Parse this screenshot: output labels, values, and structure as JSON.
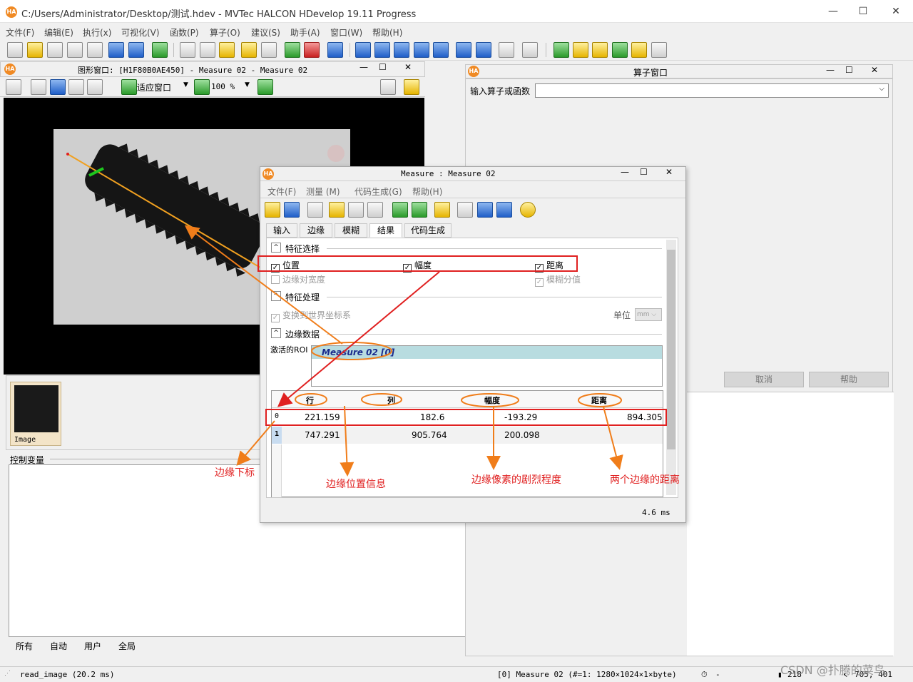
{
  "app": {
    "title": "C:/Users/Administrator/Desktop/测试.hdev - MVTec HALCON HDevelop 19.11 Progress",
    "min": "—",
    "max": "☐",
    "close": "✕",
    "logo": "HA"
  },
  "menu": [
    "文件(F)",
    "编辑(E)",
    "执行(x)",
    "可视化(V)",
    "函数(P)",
    "算子(O)",
    "建议(S)",
    "助手(A)",
    "窗口(W)",
    "帮助(H)"
  ],
  "graphics": {
    "title": "图形窗口: [H1F80B0AE450] - Measure 02 - Measure 02",
    "fit": "适应窗口",
    "zoom": "100 %"
  },
  "variables": {
    "image_label": "Image",
    "control_label": "控制变量",
    "tabs": [
      "所有",
      "自动",
      "用户",
      "全局"
    ]
  },
  "operator": {
    "title": "算子窗口",
    "label": "输入算子或函数",
    "cancel": "取消",
    "help": "帮助"
  },
  "measure": {
    "title": "Measure : Measure 02",
    "menu": [
      "文件(F)",
      "测量 (M)",
      "代码生成(G)",
      "帮助(H)"
    ],
    "tabs": [
      "输入",
      "边缘",
      "模糊",
      "结果",
      "代码生成"
    ],
    "active_tab": "结果",
    "sec_feature": "特征选择",
    "chk_position": "位置",
    "chk_amplitude": "幅度",
    "chk_distance": "距离",
    "chk_pairwidth": "边缘对宽度",
    "chk_fuzzy": "模糊分值",
    "sec_process": "特征处理",
    "chk_world": "变换到世界坐标系",
    "unit_label": "单位",
    "unit_value": "mm",
    "sec_edges": "边缘数据",
    "roi_label": "激活的ROI",
    "roi_item": "Measure 02 [0]",
    "table_headers": [
      "行",
      "列",
      "幅度",
      "距离"
    ],
    "rows": [
      {
        "idx": "0",
        "row": "221.159",
        "col": "182.6",
        "amp": "-193.29",
        "dist": "894.305"
      },
      {
        "idx": "1",
        "row": "747.291",
        "col": "905.764",
        "amp": "200.098",
        "dist": ""
      }
    ],
    "time": "4.6 ms"
  },
  "annotations": {
    "index": "边缘下标",
    "position": "边缘位置信息",
    "amplitude": "边缘像素的剧烈程度",
    "distance": "两个边缘的距离"
  },
  "status": {
    "left": "read_image (20.2 ms)",
    "mid": "[0] Measure 02 (#=1: 1280×1024×1×byte)",
    "timer": "-",
    "value": "218",
    "coords": "705, 401",
    "watermark": "CSDN @扑腾的菜鸟"
  }
}
